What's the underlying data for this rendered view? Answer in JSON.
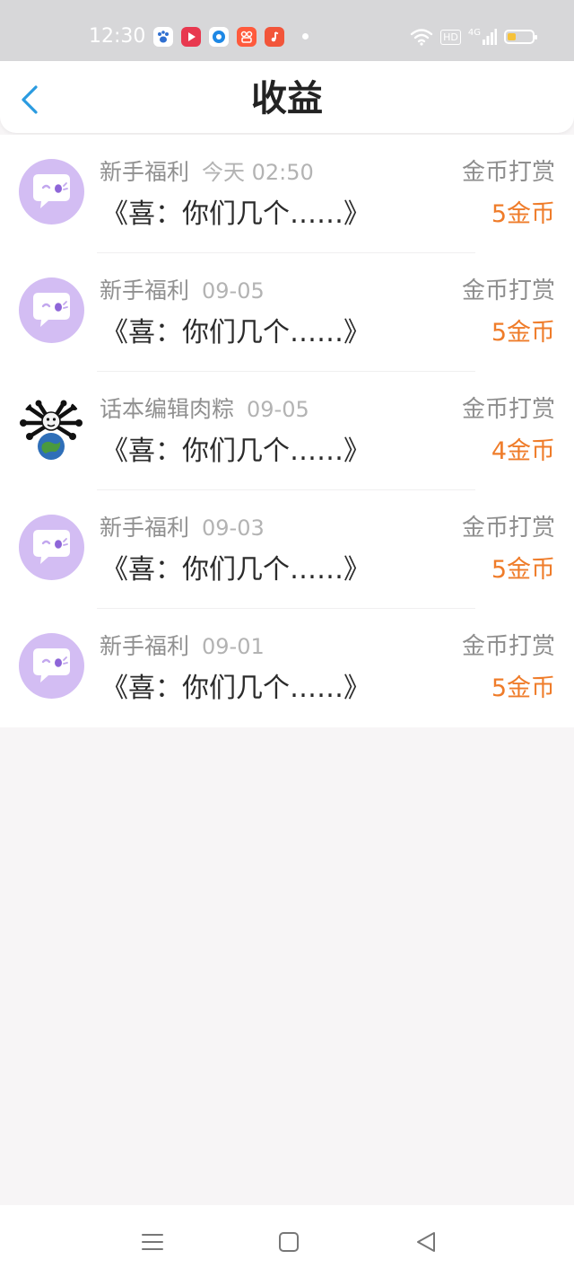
{
  "status_bar": {
    "time": "12:30",
    "apps": [
      "baidu-app-icon",
      "video-app-icon",
      "browser-app-icon",
      "kuaishou-app-icon",
      "music-app-icon"
    ],
    "network": "4G",
    "hd": "HD",
    "battery_level": 0.35
  },
  "header": {
    "title": "收益"
  },
  "earnings": [
    {
      "name": "新手福利",
      "date": "今天 02:50",
      "work": "《喜：你们几个……》",
      "type": "金币打赏",
      "amount": "5金币",
      "avatar": "bot"
    },
    {
      "name": "新手福利",
      "date": "09-05",
      "work": "《喜：你们几个……》",
      "type": "金币打赏",
      "amount": "5金币",
      "avatar": "bot"
    },
    {
      "name": "话本编辑肉粽",
      "date": "09-05",
      "work": "《喜：你们几个……》",
      "type": "金币打赏",
      "amount": "4金币",
      "avatar": "editor"
    },
    {
      "name": "新手福利",
      "date": "09-03",
      "work": "《喜：你们几个……》",
      "type": "金币打赏",
      "amount": "5金币",
      "avatar": "bot"
    },
    {
      "name": "新手福利",
      "date": "09-01",
      "work": "《喜：你们几个……》",
      "type": "金币打赏",
      "amount": "5金币",
      "avatar": "bot"
    }
  ],
  "colors": {
    "accent": "#2a9be0",
    "amount": "#ef7c2a",
    "avatar_bg": "#d3bdf3",
    "status_bar": "#d7d7d9"
  }
}
